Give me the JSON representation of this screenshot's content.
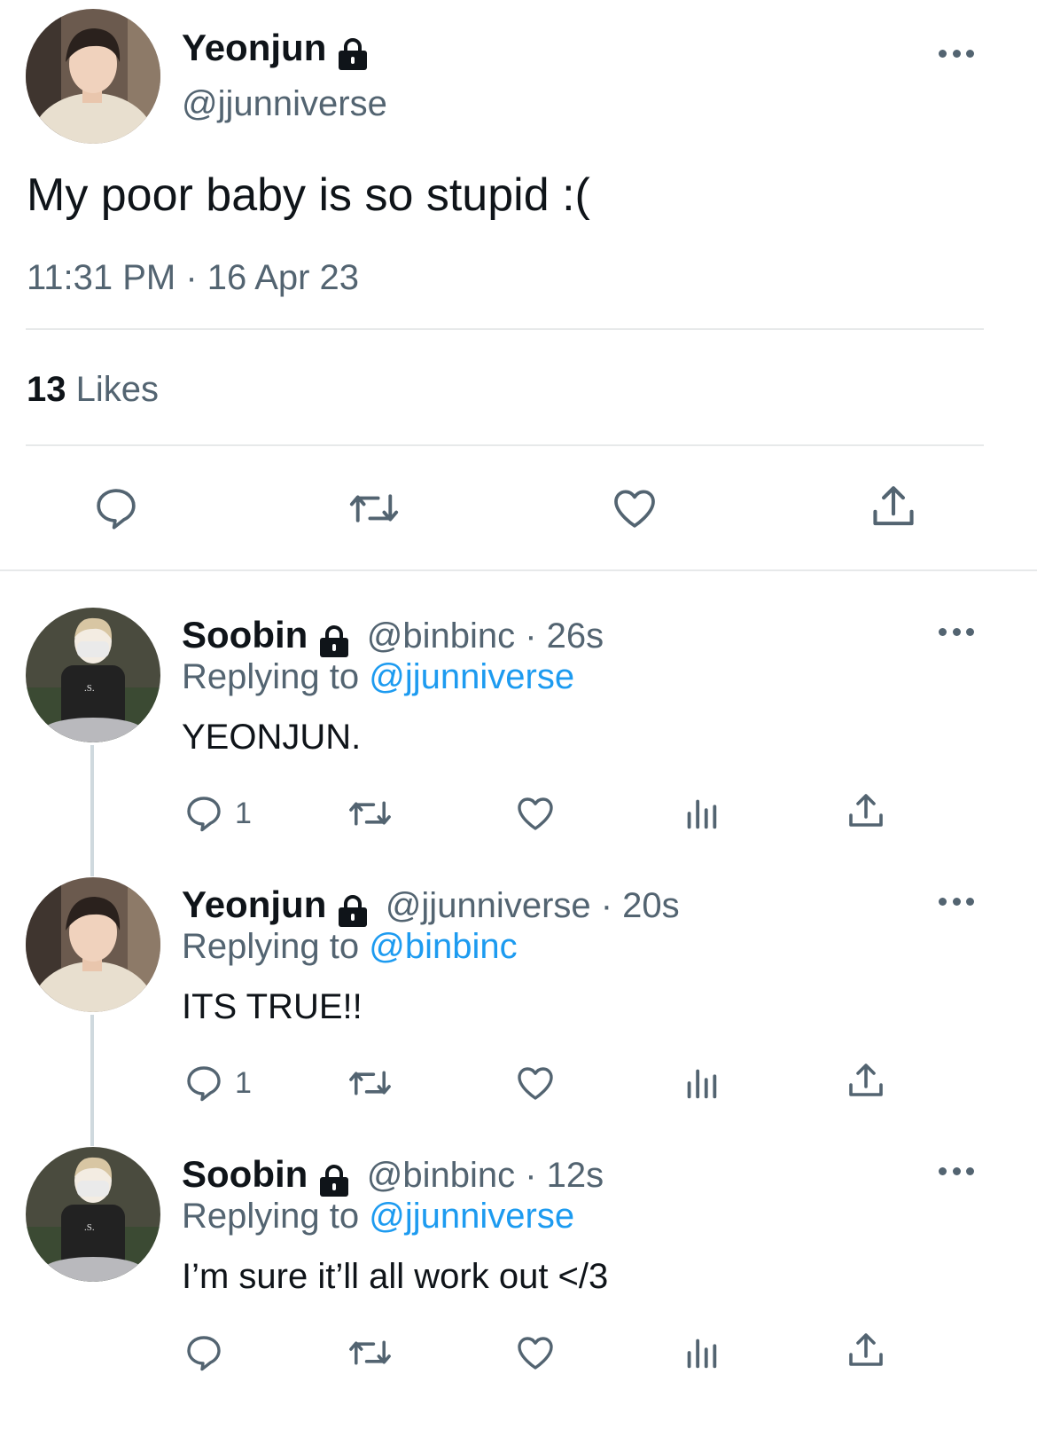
{
  "main_tweet": {
    "display_name": "Yeonjun",
    "handle": "@jjunniverse",
    "text": "My poor baby is so stupid :(",
    "timestamp": "11:31 PM · 16 Apr 23",
    "likes_count": "13",
    "likes_label": "Likes"
  },
  "replies": [
    {
      "display_name": "Soobin",
      "handle_time": "@binbinc · 26s",
      "replying_prefix": "Replying to",
      "replying_to": "@jjunniverse",
      "text": "YEONJUN.",
      "reply_count": "1"
    },
    {
      "display_name": "Yeonjun",
      "handle_time": "@jjunniverse · 20s",
      "replying_prefix": "Replying to",
      "replying_to": "@binbinc",
      "text": "ITS TRUE!!",
      "reply_count": "1"
    },
    {
      "display_name": "Soobin",
      "handle_time": "@binbinc · 12s",
      "replying_prefix": "Replying to",
      "replying_to": "@jjunniverse",
      "text": "I’m sure it’ll all work out </3",
      "reply_count": ""
    }
  ],
  "icons": {
    "lock": "lock-icon",
    "more": "more-icon",
    "reply": "reply-icon",
    "retweet": "retweet-icon",
    "like": "heart-icon",
    "views": "views-icon",
    "share": "share-icon"
  },
  "colors": {
    "text": "#0f1419",
    "secondary": "#536471",
    "link": "#1d9bf0",
    "divider": "#e7e9ea"
  }
}
